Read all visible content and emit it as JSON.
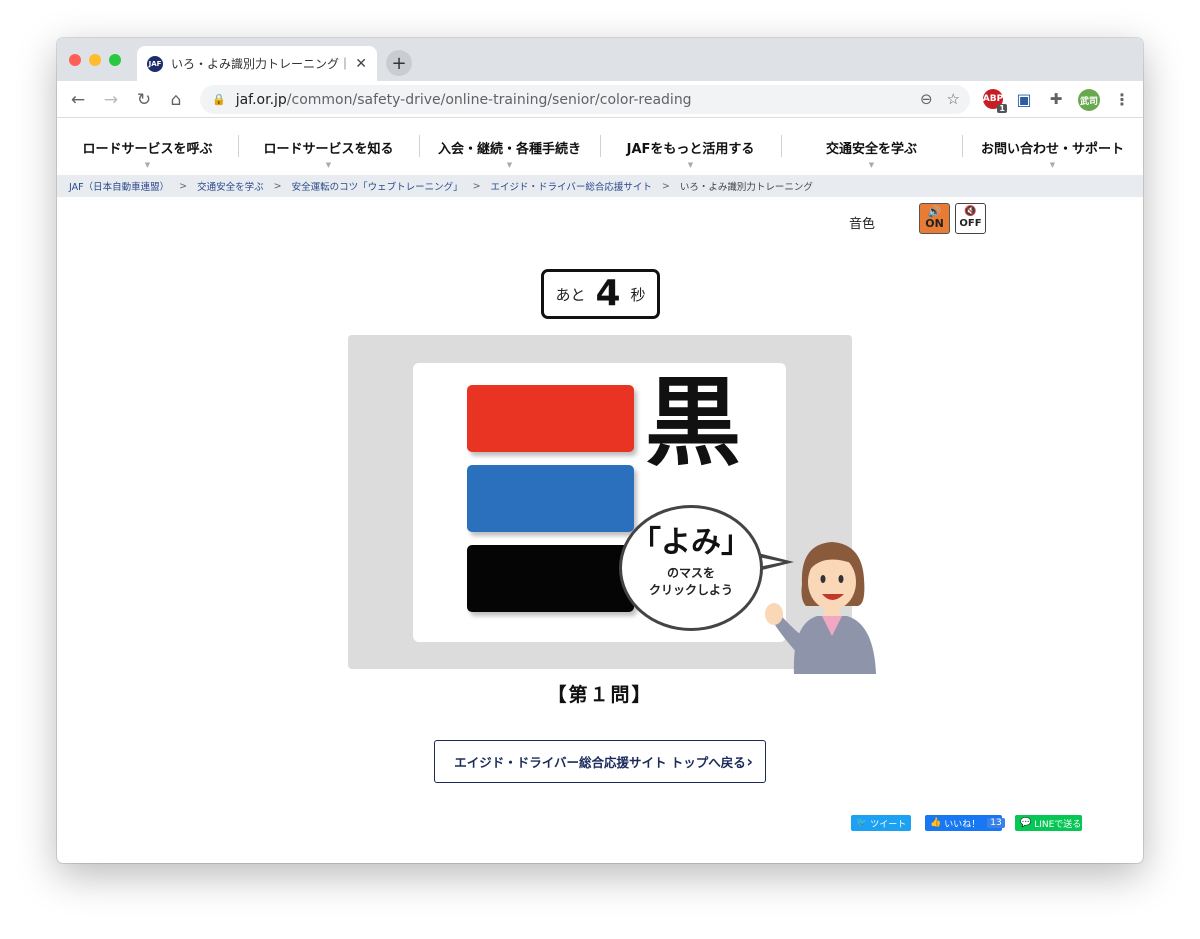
{
  "browser": {
    "tab_title": "いろ・よみ識別力トレーニング｜JAF",
    "tab_favicon_text": "JAF",
    "url_host": "jaf.or.jp",
    "url_path": "/common/safety-drive/online-training/senior/color-reading",
    "abp_badge": "1",
    "avatar_text": "武司"
  },
  "nav": {
    "items": [
      "ロードサービスを呼ぶ",
      "ロードサービスを知る",
      "入会・継続・各種手続き",
      "JAFをもっと活用する",
      "交通安全を学ぶ",
      "お問い合わせ・サポート"
    ]
  },
  "breadcrumb": [
    "JAF（日本自動車連盟）",
    "交通安全を学ぶ",
    "安全運転のコツ「ウェブトレーニング」",
    "エイジド・ドライバー総合応援サイト",
    "いろ・よみ識別力トレーニング"
  ],
  "sound": {
    "label": "音色",
    "on_icon": "🔊",
    "on_text": "ON",
    "off_icon": "🔇",
    "off_text": "OFF"
  },
  "timer": {
    "prefix": "あと",
    "seconds": "4",
    "suffix": "秒"
  },
  "quiz": {
    "word": "黒",
    "swatches": [
      {
        "name": "red",
        "color": "#e93323"
      },
      {
        "name": "blue",
        "color": "#2b70bd"
      },
      {
        "name": "black",
        "color": "#050505"
      }
    ],
    "bubble_main": "「よみ」",
    "bubble_line1": "のマスを",
    "bubble_line2": "クリックしよう",
    "question_label": "【第１問】"
  },
  "back_button": "エイジド・ドライバー総合応援サイト トップへ戻る",
  "share": {
    "tweet": "ツイート",
    "like": "いいね！",
    "like_count": "13",
    "line": "LINEで送る"
  }
}
